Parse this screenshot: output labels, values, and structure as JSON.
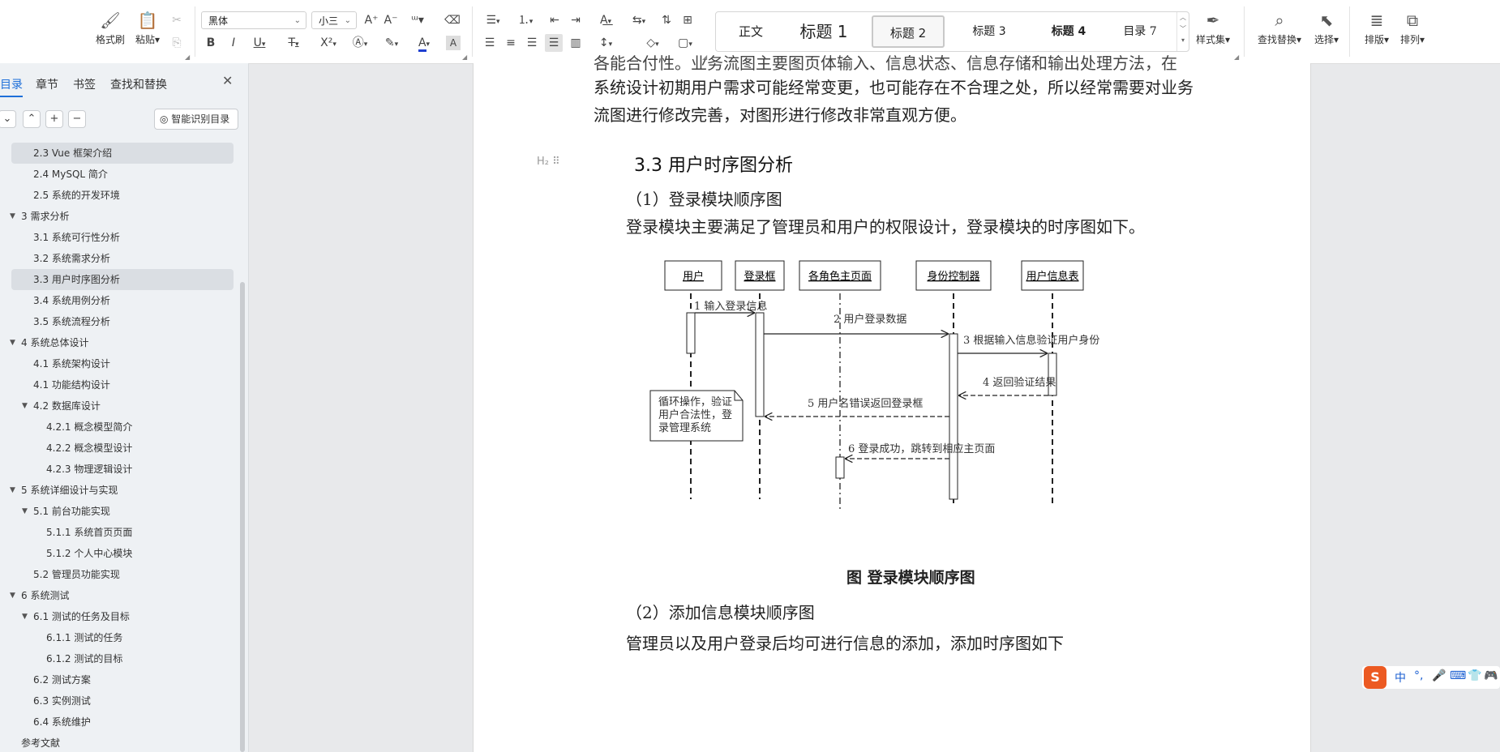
{
  "ribbon": {
    "clipboard": {
      "format_painter": "格式刷",
      "paste": "粘贴"
    },
    "font": {
      "name": "黑体",
      "size": "小三",
      "bold": "B",
      "italic": "I",
      "underline": "U",
      "strike": "Ŧ",
      "superscript": "X²",
      "font_color_letter": "A",
      "char_shading": "A"
    },
    "paragraph": {},
    "styles": {
      "items": [
        "正文",
        "标题 1",
        "标题 2",
        "标题 3",
        "标题 4",
        "目录 7"
      ],
      "active": "标题 2"
    },
    "style_set": "样式集",
    "find_replace": "查找替换",
    "select": "选择",
    "layout": "排版",
    "arrange": "排列"
  },
  "nav": {
    "tabs": [
      "目录",
      "章节",
      "书签",
      "查找和替换"
    ],
    "active_tab": "目录",
    "smart_toc": "智能识别目录",
    "toc": [
      {
        "label": "2.3 Vue 框架介绍",
        "level": 2,
        "selected": true
      },
      {
        "label": "2.4 MySQL 简介",
        "level": 2
      },
      {
        "label": "2.5 系统的开发环境",
        "level": 2
      },
      {
        "label": "3  需求分析",
        "level": 1,
        "expanded": true
      },
      {
        "label": "3.1 系统可行性分析",
        "level": 2
      },
      {
        "label": "3.2 系统需求分析",
        "level": 2
      },
      {
        "label": "3.3 用户时序图分析",
        "level": 2,
        "selected": true
      },
      {
        "label": "3.4  系统用例分析",
        "level": 2
      },
      {
        "label": "3.5 系统流程分析",
        "level": 2
      },
      {
        "label": "4  系统总体设计",
        "level": 1,
        "expanded": true
      },
      {
        "label": "4.1 系统架构设计",
        "level": 2
      },
      {
        "label": "4.1 功能结构设计",
        "level": 2
      },
      {
        "label": "4.2 数据库设计",
        "level": 2,
        "expanded": true
      },
      {
        "label": "4.2.1  概念模型简介",
        "level": 3
      },
      {
        "label": "4.2.2  概念模型设计",
        "level": 3
      },
      {
        "label": "4.2.3  物理逻辑设计",
        "level": 3
      },
      {
        "label": "5  系统详细设计与实现",
        "level": 1,
        "expanded": true
      },
      {
        "label": "5.1 前台功能实现",
        "level": 2,
        "expanded": true
      },
      {
        "label": "5.1.1 系统首页页面",
        "level": 3
      },
      {
        "label": "5.1.2 个人中心模块",
        "level": 3
      },
      {
        "label": "5.2 管理员功能实现",
        "level": 2
      },
      {
        "label": "6  系统测试",
        "level": 1,
        "expanded": true
      },
      {
        "label": "6.1  测试的任务及目标",
        "level": 2,
        "expanded": true
      },
      {
        "label": "6.1.1    测试的任务",
        "level": 3
      },
      {
        "label": "6.1.2    测试的目标",
        "level": 3
      },
      {
        "label": "6.2    测试方案",
        "level": 2
      },
      {
        "label": "6.3    实例测试",
        "level": 2
      },
      {
        "label": "6.4    系统维护",
        "level": 2
      },
      {
        "label": "参考文献",
        "level": 0
      }
    ]
  },
  "document": {
    "para_top_partial": "各能合付性。业务流图主要图页体输入、信息状态、信息存储和输出处理方法，在",
    "para_line2": "系统设计初期用户需求可能经常变更，也可能存在不合理之处，所以经常需要对业务",
    "para_line3": "流图进行修改完善，对图形进行修改非常直观方便。",
    "heading_marker": "H₂ ⠿",
    "heading": "3.3 用户时序图分析",
    "sub1": "（1）登录模块顺序图",
    "para_login": "登录模块主要满足了管理员和用户的权限设计，登录模块的时序图如下。",
    "diagram": {
      "actors": [
        "用户",
        "登录框",
        "各角色主页面",
        "身份控制器",
        "用户信息表"
      ],
      "messages": [
        "1 输入登录信息",
        "2 用户登录数据",
        "3 根据输入信息验证用户身份",
        "4 返回验证结果",
        "5 用户名错误返回登录框",
        "6 登录成功，跳转到相应主页面"
      ],
      "note_lines": [
        "循环操作，验证",
        "用户合法性，登",
        "录管理系统"
      ]
    },
    "caption": "图  登录模块顺序图",
    "sub2": "（2）添加信息模块顺序图",
    "para_add": "管理员以及用户登录后均可进行信息的添加，添加时序图如下"
  },
  "ime": {
    "logo": "S",
    "lang": "中",
    "punct": "°,",
    "mic": "🎤",
    "keyboard": "⌨",
    "skin": "👕",
    "tools": "🎮"
  }
}
